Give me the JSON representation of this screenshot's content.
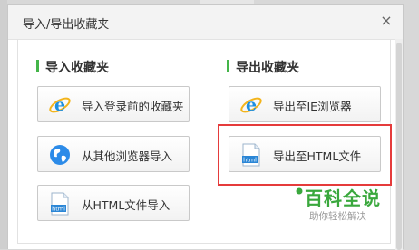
{
  "dialog": {
    "title": "导入/导出收藏夹",
    "close_symbol": "×"
  },
  "import_section": {
    "heading": "导入收藏夹",
    "buttons": [
      {
        "label": "导入登录前的收藏夹",
        "icon": "ie-icon"
      },
      {
        "label": "从其他浏览器导入",
        "icon": "globe-icon"
      },
      {
        "label": "从HTML文件导入",
        "icon": "html-file-icon"
      }
    ]
  },
  "export_section": {
    "heading": "导出收藏夹",
    "buttons": [
      {
        "label": "导出至IE浏览器",
        "icon": "ie-icon"
      },
      {
        "label": "导出至HTML文件",
        "icon": "html-file-icon"
      }
    ]
  },
  "watermark": {
    "title": "百科全说",
    "subtitle": "助你轻松解决"
  },
  "file_icon_text": "html",
  "colors": {
    "accent_green": "#44b549",
    "highlight_red": "#e53b3b",
    "ie_blue": "#1d8fe0"
  }
}
